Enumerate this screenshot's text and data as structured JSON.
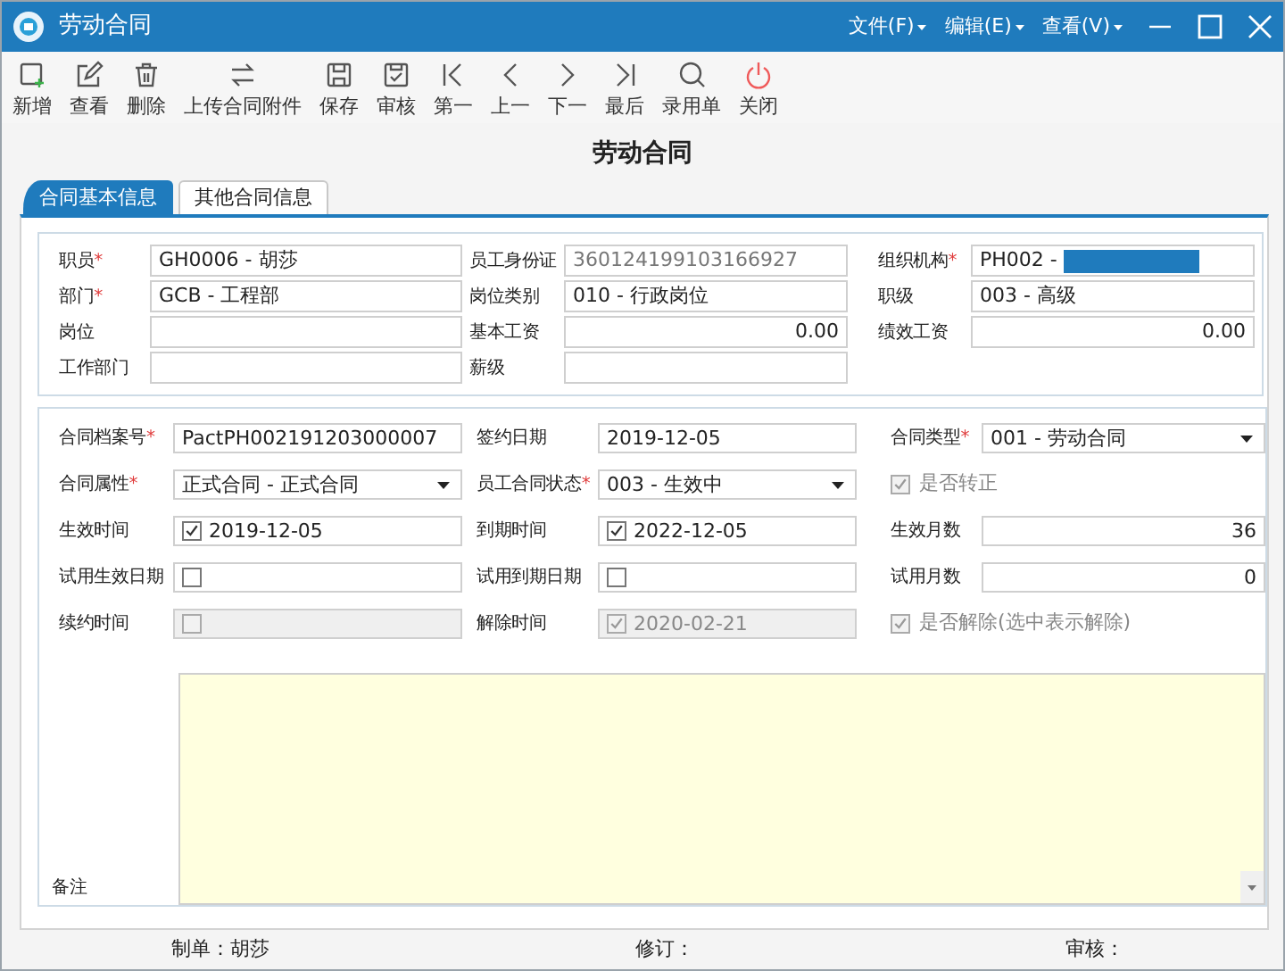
{
  "window": {
    "title": "劳动合同"
  },
  "menus": [
    {
      "label": "文件(F)"
    },
    {
      "label": "编辑(E)"
    },
    {
      "label": "查看(V)"
    }
  ],
  "toolbar": [
    {
      "label": "新增"
    },
    {
      "label": "查看"
    },
    {
      "label": "删除"
    },
    {
      "label": "上传合同附件"
    },
    {
      "label": "保存"
    },
    {
      "label": "审核"
    },
    {
      "label": "第一"
    },
    {
      "label": "上一"
    },
    {
      "label": "下一"
    },
    {
      "label": "最后"
    },
    {
      "label": "录用单"
    },
    {
      "label": "关闭"
    }
  ],
  "heading": "劳动合同",
  "tabs": [
    {
      "label": "合同基本信息",
      "selected": true
    },
    {
      "label": "其他合同信息",
      "selected": false
    }
  ],
  "basic_fields": [
    {
      "label": "职员",
      "required_mark": "*",
      "value": "GH0006 - 胡莎"
    },
    {
      "label": "员工身份证",
      "value": "360124199103166927",
      "readonly": true
    },
    {
      "label": "组织机构",
      "required_mark": "*",
      "value": "PH002 -",
      "redacted": true
    },
    {
      "label": "部门",
      "required_mark": "*",
      "value": "GCB - 工程部"
    },
    {
      "label": "岗位类别",
      "value": "010 - 行政岗位"
    },
    {
      "label": "职级",
      "value": "003 - 高级"
    },
    {
      "label": "岗位"
    },
    {
      "label": "基本工资",
      "value": "0.00",
      "right_aligned": true
    },
    {
      "label": "绩效工资",
      "value": "0.00",
      "right_aligned": true
    },
    {
      "label": "工作部门"
    },
    {
      "label": "薪级"
    }
  ],
  "contract_fields": [
    {
      "kind": "text",
      "label": "合同档案号",
      "required_mark": "*",
      "value": "PactPH002191203000007"
    },
    {
      "kind": "text",
      "label": "签约日期",
      "value": "2019-12-05"
    },
    {
      "kind": "select",
      "label": "合同类型",
      "required_mark": "*",
      "value": "001 - 劳动合同"
    },
    {
      "kind": "select",
      "label": "合同属性",
      "required_mark": "*",
      "value": "正式合同 - 正式合同"
    },
    {
      "kind": "select",
      "label": "员工合同状态",
      "required_mark": "*",
      "value": "003 - 生效中"
    },
    {
      "kind": "checkbox",
      "label": "是否转正",
      "checked": true,
      "disabled": true
    },
    {
      "kind": "date",
      "label": "生效时间",
      "checked": true,
      "value": "2019-12-05"
    },
    {
      "kind": "date",
      "label": "到期时间",
      "checked": true,
      "value": "2022-12-05"
    },
    {
      "kind": "text",
      "label": "生效月数",
      "value": "36",
      "right_aligned": true
    },
    {
      "kind": "date",
      "label": "试用生效日期",
      "checked": false
    },
    {
      "kind": "date",
      "label": "试用到期日期",
      "checked": false
    },
    {
      "kind": "text",
      "label": "试用月数",
      "value": "0",
      "right_aligned": true
    },
    {
      "kind": "date",
      "label": "续约时间",
      "checked": false,
      "disabled": true
    },
    {
      "kind": "date",
      "label": "解除时间",
      "checked": true,
      "disabled": true,
      "value": "2020-02-21"
    },
    {
      "kind": "checkbox",
      "label": "是否解除(选中表示解除)",
      "checked": true,
      "disabled": true
    }
  ],
  "memo": {
    "label": "备注"
  },
  "footer": [
    {
      "label": "制单：胡莎"
    },
    {
      "label": "修订："
    },
    {
      "label": "审核："
    }
  ]
}
